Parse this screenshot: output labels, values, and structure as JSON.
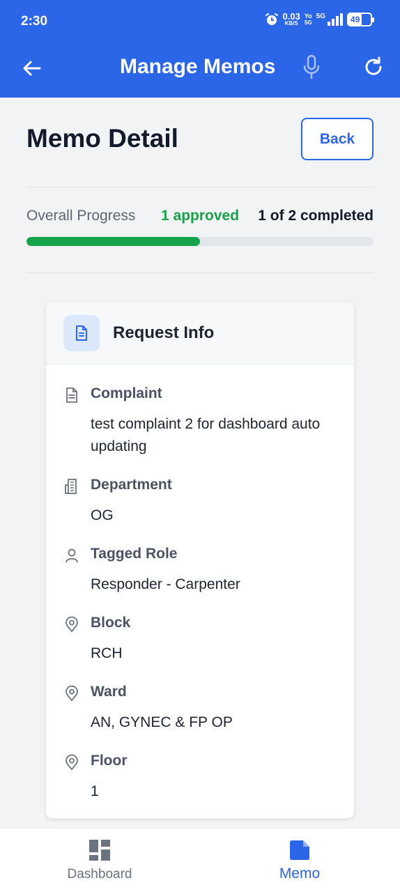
{
  "status_bar": {
    "time": "2:30",
    "net_speed": "0.03",
    "net_unit": "KB/S",
    "sim": "Yo",
    "sim_sub": "5G",
    "network": "5G",
    "battery": "49"
  },
  "appbar": {
    "title": "Manage Memos",
    "back_icon": "arrow-left-icon",
    "mic_icon": "microphone-icon",
    "refresh_icon": "refresh-icon"
  },
  "page": {
    "title": "Memo Detail",
    "back_button_label": "Back"
  },
  "progress": {
    "label": "Overall Progress",
    "approved_text": "1 approved",
    "completed_text": "1 of 2 completed",
    "fraction": 0.5
  },
  "card": {
    "title": "Request Info",
    "icon": "document-icon",
    "fields": [
      {
        "icon": "document-icon",
        "label": "Complaint",
        "value": "test complaint 2 for dashboard auto updating"
      },
      {
        "icon": "building-icon",
        "label": "Department",
        "value": "OG"
      },
      {
        "icon": "user-icon",
        "label": "Tagged Role",
        "value": "Responder - Carpenter"
      },
      {
        "icon": "location-pin-icon",
        "label": "Block",
        "value": "RCH"
      },
      {
        "icon": "location-pin-icon",
        "label": "Ward",
        "value": "AN, GYNEC & FP OP"
      },
      {
        "icon": "location-pin-icon",
        "label": "Floor",
        "value": "1"
      }
    ]
  },
  "bottom_nav": {
    "items": [
      {
        "label": "Dashboard",
        "icon": "dashboard-grid-icon",
        "active": false
      },
      {
        "label": "Memo",
        "icon": "memo-icon",
        "active": true
      }
    ]
  },
  "colors": {
    "primary": "#2b65e8",
    "success": "#16a34a",
    "background": "#f2f3f5"
  }
}
